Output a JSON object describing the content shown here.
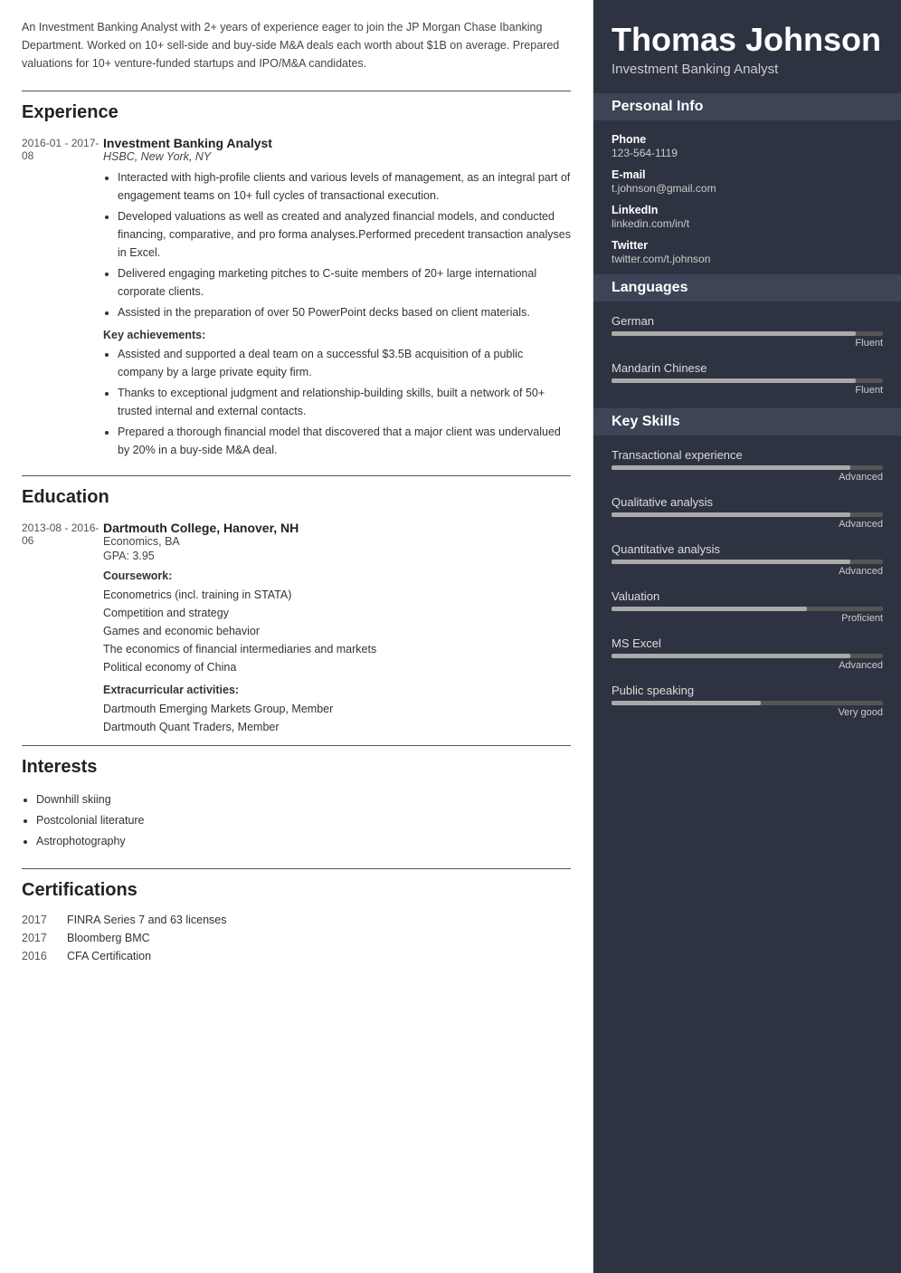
{
  "summary": "An Investment Banking Analyst with 2+ years of experience eager to join the JP Morgan Chase Ibanking Department. Worked on 10+ sell-side and buy-side M&A deals each worth about $1B on average. Prepared valuations for 10+ venture-funded startups and IPO/M&A candidates.",
  "sections": {
    "experience_title": "Experience",
    "education_title": "Education",
    "interests_title": "Interests",
    "certifications_title": "Certifications"
  },
  "experience": [
    {
      "date": "2016-01 - 2017-08",
      "title": "Investment Banking Analyst",
      "company": "HSBC, New York, NY",
      "bullets": [
        "Interacted with high-profile clients and various levels of management, as an integral part of engagement teams on 10+ full cycles of transactional execution.",
        "Developed valuations as well as created and analyzed financial models, and conducted financing, comparative, and pro forma analyses.Performed precedent transaction analyses in Excel.",
        "Delivered engaging marketing pitches to C-suite members of 20+ large international corporate clients.",
        "Assisted in the preparation of over 50 PowerPoint decks based on client materials."
      ],
      "achievements_label": "Key achievements:",
      "achievements": [
        "Assisted and supported a deal team on a successful $3.5B acquisition of a public company by a large private equity firm.",
        "Thanks to exceptional judgment and relationship-building skills, built a network of 50+ trusted internal and external contacts.",
        "Prepared a thorough financial model that discovered that a major client was undervalued by 20% in a buy-side M&A deal."
      ]
    }
  ],
  "education": [
    {
      "date": "2013-08 - 2016-06",
      "school": "Dartmouth College, Hanover, NH",
      "degree": "Economics, BA",
      "gpa": "GPA: 3.95",
      "coursework_label": "Coursework:",
      "coursework": [
        "Econometrics (incl. training in STATA)",
        "Competition and strategy",
        "Games and economic behavior",
        "The economics of financial intermediaries and markets",
        "Political economy of China"
      ],
      "extracurricular_label": "Extracurricular activities:",
      "extracurricular": [
        "Dartmouth Emerging Markets Group, Member",
        "Dartmouth Quant Traders, Member"
      ]
    }
  ],
  "interests": [
    "Downhill skiing",
    "Postcolonial literature",
    "Astrophotography"
  ],
  "certifications": [
    {
      "year": "2017",
      "name": "FINRA Series 7 and 63 licenses"
    },
    {
      "year": "2017",
      "name": "Bloomberg BMC"
    },
    {
      "year": "2016",
      "name": "CFA Certification"
    }
  ],
  "right": {
    "name": "Thomas Johnson",
    "title": "Investment Banking Analyst",
    "personal_info_title": "Personal Info",
    "phone_label": "Phone",
    "phone": "123-564-1119",
    "email_label": "E-mail",
    "email": "t.johnson@gmail.com",
    "linkedin_label": "LinkedIn",
    "linkedin": "linkedin.com/in/t",
    "twitter_label": "Twitter",
    "twitter": "twitter.com/t.johnson",
    "languages_title": "Languages",
    "languages": [
      {
        "name": "German",
        "level": "Fluent",
        "pct": 90
      },
      {
        "name": "Mandarin Chinese",
        "level": "Fluent",
        "pct": 90
      }
    ],
    "skills_title": "Key Skills",
    "skills": [
      {
        "name": "Transactional experience",
        "level": "Advanced",
        "pct": 88
      },
      {
        "name": "Qualitative analysis",
        "level": "Advanced",
        "pct": 88
      },
      {
        "name": "Quantitative analysis",
        "level": "Advanced",
        "pct": 88
      },
      {
        "name": "Valuation",
        "level": "Proficient",
        "pct": 72
      },
      {
        "name": "MS Excel",
        "level": "Advanced",
        "pct": 88
      },
      {
        "name": "Public speaking",
        "level": "Very good",
        "pct": 55
      }
    ]
  }
}
